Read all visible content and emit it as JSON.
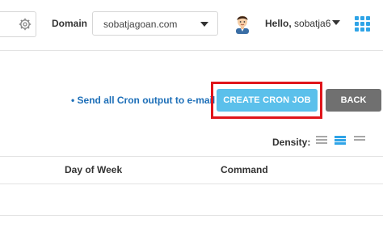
{
  "header": {
    "domain_label": "Domain",
    "domain_value": "sobatjagoan.com",
    "greeting": "Hello,",
    "username": "sobatja6"
  },
  "actions": {
    "email_link": "• Send all Cron output to e-mail",
    "create_button": "CREATE CRON JOB",
    "back_button": "BACK"
  },
  "density": {
    "label": "Density:",
    "options": [
      "compact",
      "normal",
      "comfortable"
    ],
    "selected": "normal"
  },
  "table": {
    "columns": [
      "Day of Week",
      "Command"
    ]
  },
  "colors": {
    "accent": "#5bc0eb",
    "highlight": "#e0151b",
    "back": "#707070",
    "link": "#1d6fb8"
  }
}
